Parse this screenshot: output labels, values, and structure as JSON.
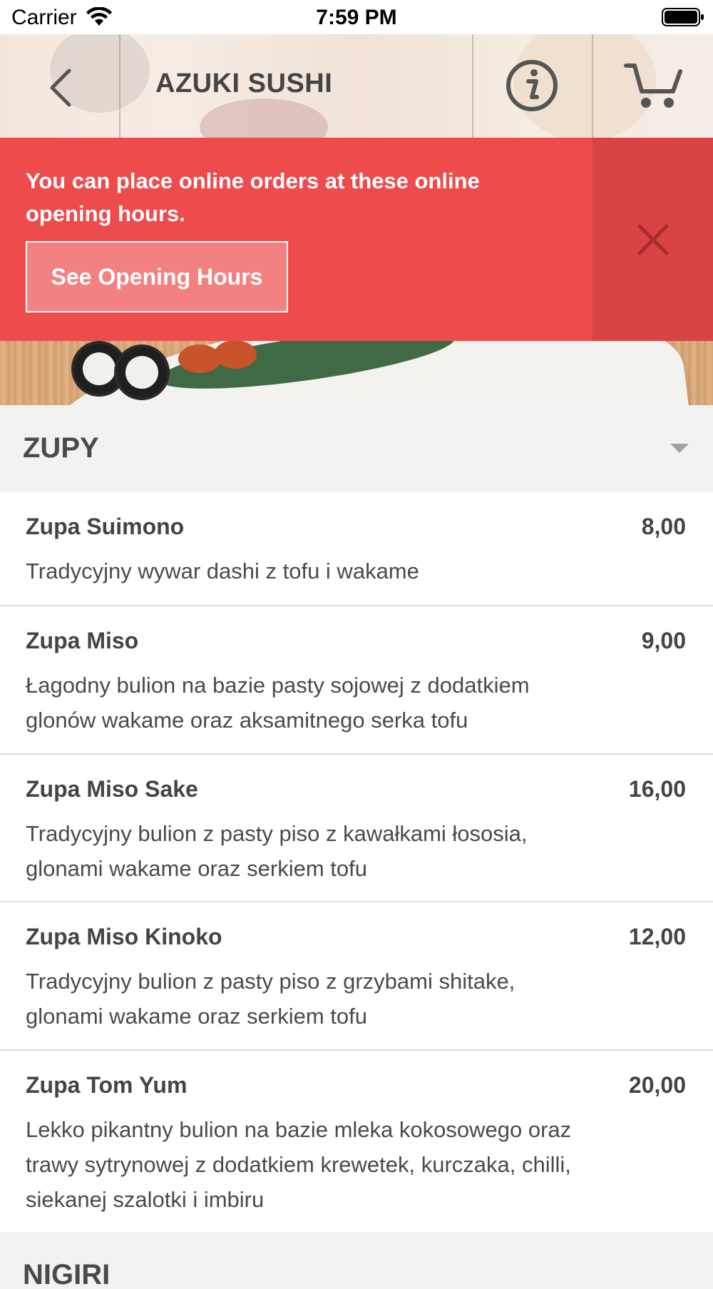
{
  "status_bar": {
    "carrier": "Carrier",
    "time": "7:59 PM"
  },
  "header": {
    "title": "AZUKI SUSHI",
    "back_icon": "chevron-left-icon",
    "info_icon": "info-circle-icon",
    "cart_icon": "cart-icon"
  },
  "notice": {
    "message": "You can place online orders at these online opening hours.",
    "button_label": "See Opening Hours",
    "close_icon": "close-icon",
    "color": "#ee4b4d"
  },
  "category": {
    "title": "ZUPY",
    "caret_icon": "caret-down-icon"
  },
  "items": [
    {
      "name": "Zupa Suimono",
      "price": "8,00",
      "description": "Tradycyjny wywar dashi z tofu i wakame"
    },
    {
      "name": "Zupa Miso",
      "price": "9,00",
      "description": "Łagodny bulion na bazie pasty sojowej z dodatkiem glonów wakame oraz aksamitnego serka tofu"
    },
    {
      "name": "Zupa Miso Sake",
      "price": "16,00",
      "description": "Tradycyjny bulion z pasty piso z kawałkami łososia, glonami wakame oraz serkiem tofu"
    },
    {
      "name": "Zupa Miso Kinoko",
      "price": "12,00",
      "description": "Tradycyjny bulion z pasty piso z grzybami shitake, glonami wakame oraz serkiem tofu"
    },
    {
      "name": "Zupa Tom Yum",
      "price": "20,00",
      "description": "Lekko pikantny bulion na bazie mleka kokosowego oraz trawy sytrynowej z dodatkiem krewetek, kurczaka, chilli, siekanej szalotki i imbiru"
    }
  ],
  "next_category": {
    "title": "NIGIRI"
  }
}
